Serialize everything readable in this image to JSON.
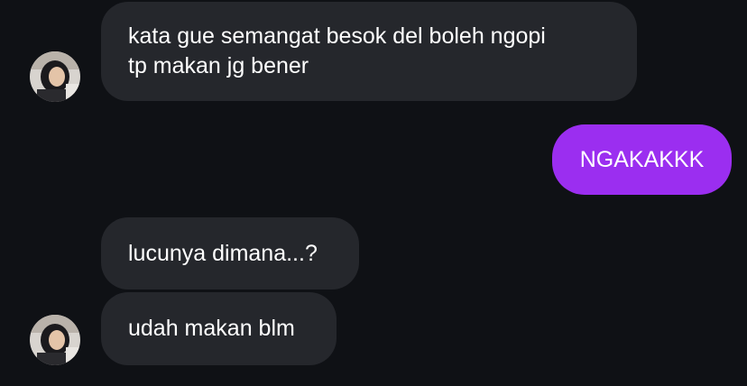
{
  "conversation": {
    "messages": [
      {
        "from": "them",
        "text": "kata gue semangat besok del boleh ngopi\ntp makan jg bener"
      },
      {
        "from": "me",
        "text": "NGAKAKKK"
      },
      {
        "from": "them",
        "text": "lucunya dimana...?"
      },
      {
        "from": "them",
        "text": "udah makan blm"
      }
    ]
  },
  "colors": {
    "background": "#0f1115",
    "incoming_bubble": "#25272c",
    "outgoing_bubble": "#9b2ef0",
    "text": "#ffffff"
  },
  "icons": {
    "avatar": "contact-avatar-photo"
  }
}
